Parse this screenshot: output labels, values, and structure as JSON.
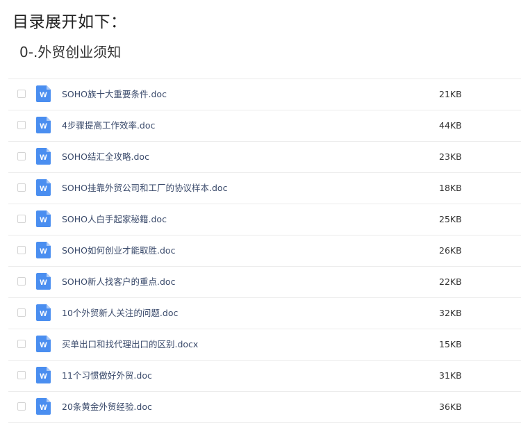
{
  "header": {
    "title": "目录展开如下：",
    "section": "0-.外贸创业须知"
  },
  "files": [
    {
      "name": "SOHO族十大重要条件.doc",
      "size": "21KB",
      "icon": "word-doc-icon"
    },
    {
      "name": "4步骤提高工作效率.doc",
      "size": "44KB",
      "icon": "word-doc-icon"
    },
    {
      "name": "SOHO结汇全攻略.doc",
      "size": "23KB",
      "icon": "word-doc-icon"
    },
    {
      "name": "SOHO挂靠外贸公司和工厂的协议样本.doc",
      "size": "18KB",
      "icon": "word-doc-icon"
    },
    {
      "name": "SOHO人白手起家秘籍.doc",
      "size": "25KB",
      "icon": "word-doc-icon"
    },
    {
      "name": "SOHO如何创业才能取胜.doc",
      "size": "26KB",
      "icon": "word-doc-icon"
    },
    {
      "name": "SOHO新人找客户的重点.doc",
      "size": "22KB",
      "icon": "word-doc-icon"
    },
    {
      "name": "10个外贸新人关注的问题.doc",
      "size": "32KB",
      "icon": "word-doc-icon"
    },
    {
      "name": "买单出口和找代理出口的区别.docx",
      "size": "15KB",
      "icon": "word-doc-icon"
    },
    {
      "name": "11个习惯做好外贸.doc",
      "size": "31KB",
      "icon": "word-doc-icon"
    },
    {
      "name": "20条黄金外贸经验.doc",
      "size": "36KB",
      "icon": "word-doc-icon"
    }
  ],
  "icon_letter": "W",
  "colors": {
    "word_icon": "#4a8ef0",
    "word_icon_fold": "#a9c8f7",
    "divider": "#ececec"
  }
}
